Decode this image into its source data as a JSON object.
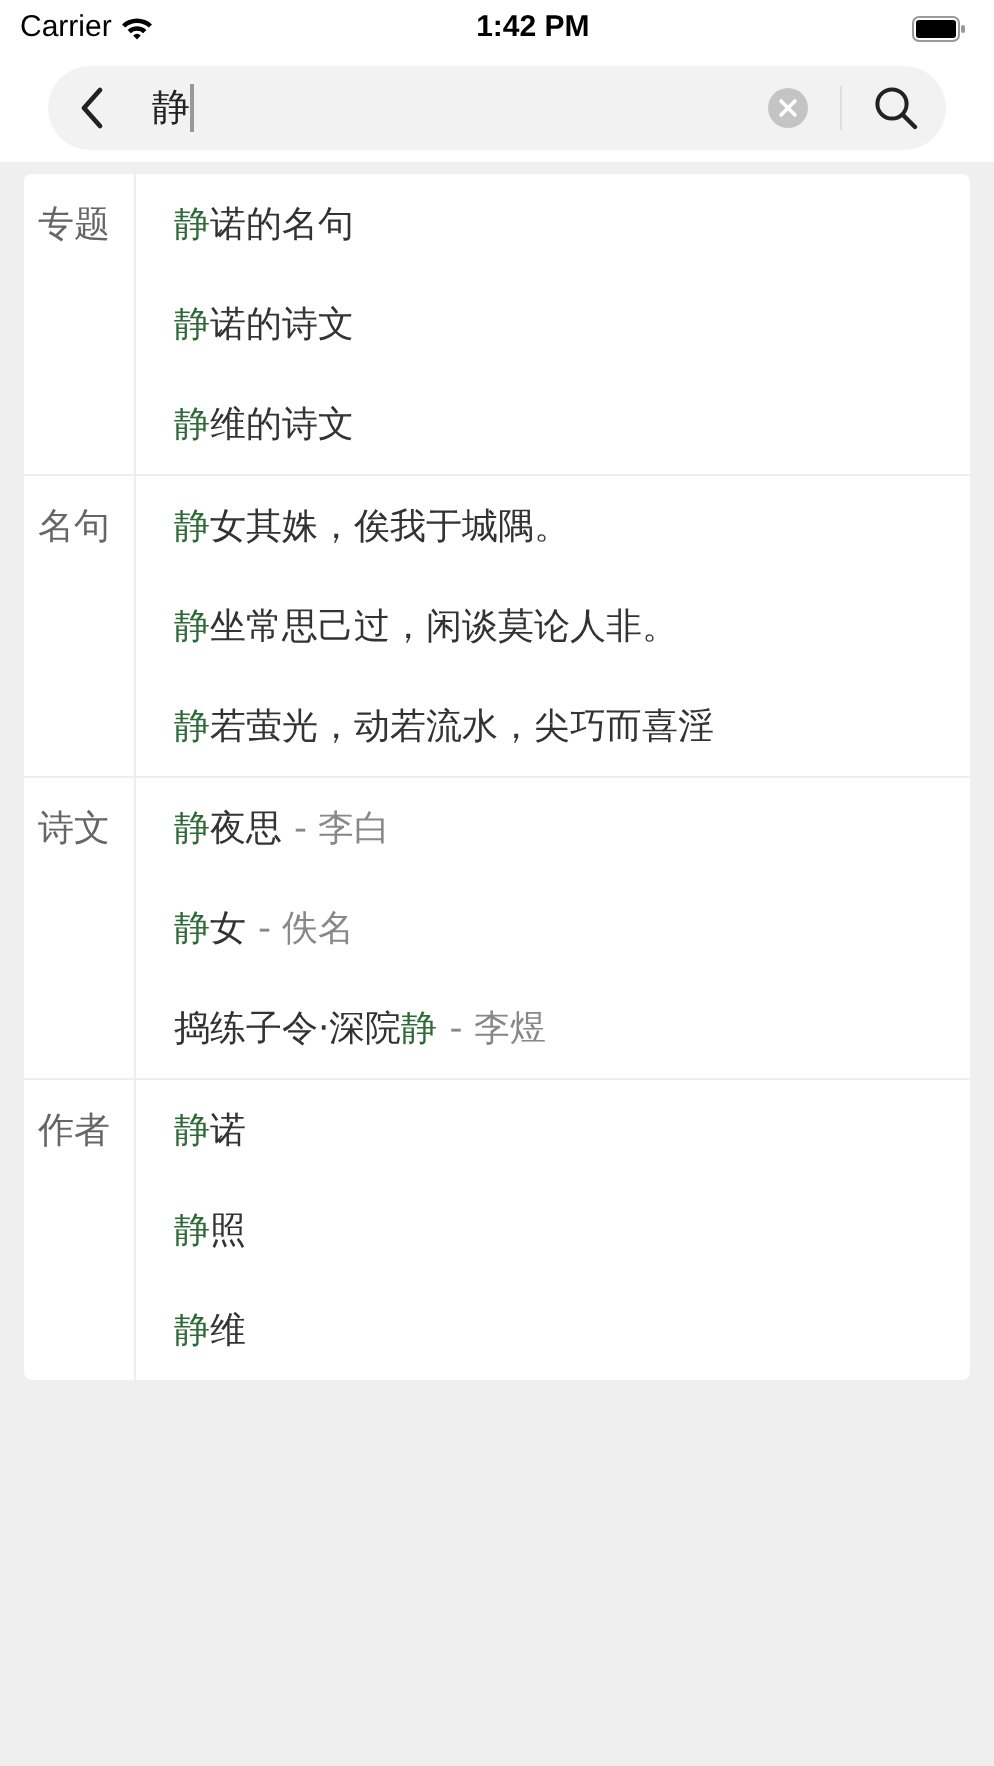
{
  "status_bar": {
    "carrier": "Carrier",
    "time": "1:42 PM"
  },
  "search": {
    "value": "静"
  },
  "sections": [
    {
      "label": "专题",
      "items": [
        {
          "parts": [
            {
              "text": "静",
              "match": true
            },
            {
              "text": "诺的名句",
              "match": false
            }
          ]
        },
        {
          "parts": [
            {
              "text": "静",
              "match": true
            },
            {
              "text": "诺的诗文",
              "match": false
            }
          ]
        },
        {
          "parts": [
            {
              "text": "静",
              "match": true
            },
            {
              "text": "维的诗文",
              "match": false
            }
          ]
        }
      ]
    },
    {
      "label": "名句",
      "items": [
        {
          "parts": [
            {
              "text": "静",
              "match": true
            },
            {
              "text": "女其姝，俟我于城隅。",
              "match": false
            }
          ]
        },
        {
          "parts": [
            {
              "text": "静",
              "match": true
            },
            {
              "text": "坐常思己过，闲谈莫论人非。",
              "match": false
            }
          ]
        },
        {
          "parts": [
            {
              "text": "静",
              "match": true
            },
            {
              "text": "若萤光，动若流水，尖巧而喜淫",
              "match": false
            }
          ]
        }
      ]
    },
    {
      "label": "诗文",
      "items": [
        {
          "parts": [
            {
              "text": "静",
              "match": true
            },
            {
              "text": "夜思",
              "match": false
            }
          ],
          "author": "- 李白"
        },
        {
          "parts": [
            {
              "text": "静",
              "match": true
            },
            {
              "text": "女",
              "match": false
            }
          ],
          "author": "- 佚名"
        },
        {
          "parts": [
            {
              "text": "捣练子令·深院",
              "match": false
            },
            {
              "text": "静",
              "match": true
            }
          ],
          "author": "- 李煜"
        }
      ]
    },
    {
      "label": "作者",
      "items": [
        {
          "parts": [
            {
              "text": "静",
              "match": true
            },
            {
              "text": "诺",
              "match": false
            }
          ]
        },
        {
          "parts": [
            {
              "text": "静",
              "match": true
            },
            {
              "text": "照",
              "match": false
            }
          ]
        },
        {
          "parts": [
            {
              "text": "静",
              "match": true
            },
            {
              "text": "维",
              "match": false
            }
          ]
        }
      ]
    }
  ]
}
